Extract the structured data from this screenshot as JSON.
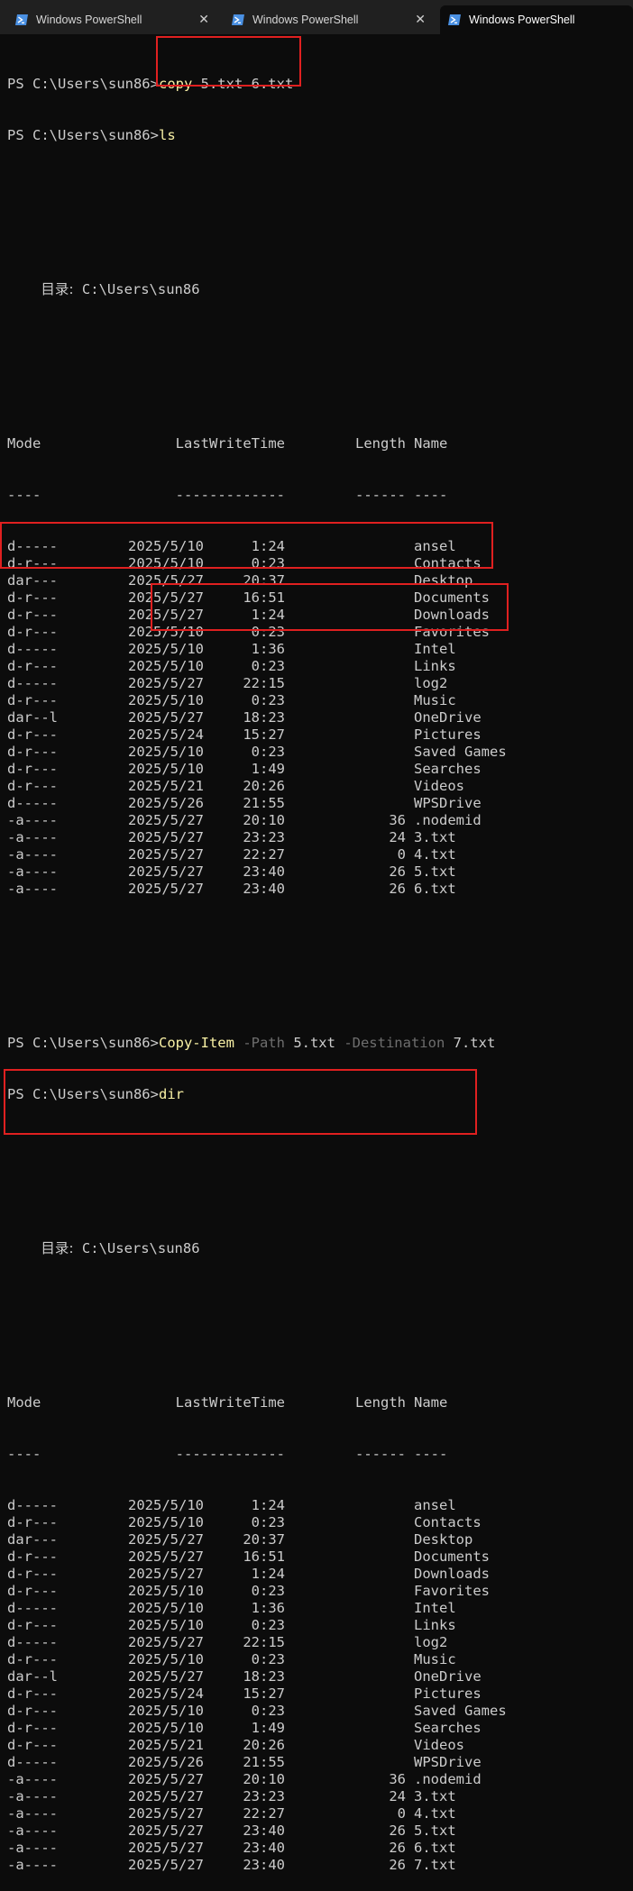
{
  "tabs": [
    {
      "label": "Windows PowerShell",
      "icon": "powershell-icon",
      "active": false,
      "close": "✕"
    },
    {
      "label": "Windows PowerShell",
      "icon": "powershell-icon",
      "active": false,
      "close": "✕"
    },
    {
      "label": "Windows PowerShell",
      "icon": "powershell-icon",
      "active": true
    }
  ],
  "prompt": "PS C:\\Users\\sun86>",
  "session1": {
    "cmd1": {
      "keyword": "copy",
      "args": " 5.txt 6.txt"
    },
    "cmd2": {
      "keyword": "ls"
    }
  },
  "session2": {
    "cmd1": {
      "keyword": "Copy-Item",
      "p1": " -Path",
      "v1": " 5.txt",
      "p2": " -Destination",
      "v2": " 7.txt"
    },
    "cmd2": {
      "keyword": "dir"
    }
  },
  "dir_header": {
    "label": "目录:",
    "path": "C:\\Users\\sun86"
  },
  "columns": {
    "mode": "Mode",
    "time": "LastWriteTime",
    "length": "Length",
    "name": "Name"
  },
  "underlines": {
    "mode": "----",
    "time": "-------------",
    "length": "------",
    "name": "----"
  },
  "listing1": [
    {
      "mode": "d-----",
      "date": "2025/5/10",
      "time": "1:24",
      "length": "",
      "name": "ansel"
    },
    {
      "mode": "d-r---",
      "date": "2025/5/10",
      "time": "0:23",
      "length": "",
      "name": "Contacts"
    },
    {
      "mode": "dar---",
      "date": "2025/5/27",
      "time": "20:37",
      "length": "",
      "name": "Desktop"
    },
    {
      "mode": "d-r---",
      "date": "2025/5/27",
      "time": "16:51",
      "length": "",
      "name": "Documents"
    },
    {
      "mode": "d-r---",
      "date": "2025/5/27",
      "time": "1:24",
      "length": "",
      "name": "Downloads"
    },
    {
      "mode": "d-r---",
      "date": "2025/5/10",
      "time": "0:23",
      "length": "",
      "name": "Favorites"
    },
    {
      "mode": "d-----",
      "date": "2025/5/10",
      "time": "1:36",
      "length": "",
      "name": "Intel"
    },
    {
      "mode": "d-r---",
      "date": "2025/5/10",
      "time": "0:23",
      "length": "",
      "name": "Links"
    },
    {
      "mode": "d-----",
      "date": "2025/5/27",
      "time": "22:15",
      "length": "",
      "name": "log2"
    },
    {
      "mode": "d-r---",
      "date": "2025/5/10",
      "time": "0:23",
      "length": "",
      "name": "Music"
    },
    {
      "mode": "dar--l",
      "date": "2025/5/27",
      "time": "18:23",
      "length": "",
      "name": "OneDrive"
    },
    {
      "mode": "d-r---",
      "date": "2025/5/24",
      "time": "15:27",
      "length": "",
      "name": "Pictures"
    },
    {
      "mode": "d-r---",
      "date": "2025/5/10",
      "time": "0:23",
      "length": "",
      "name": "Saved Games"
    },
    {
      "mode": "d-r---",
      "date": "2025/5/10",
      "time": "1:49",
      "length": "",
      "name": "Searches"
    },
    {
      "mode": "d-r---",
      "date": "2025/5/21",
      "time": "20:26",
      "length": "",
      "name": "Videos"
    },
    {
      "mode": "d-----",
      "date": "2025/5/26",
      "time": "21:55",
      "length": "",
      "name": "WPSDrive"
    },
    {
      "mode": "-a----",
      "date": "2025/5/27",
      "time": "20:10",
      "length": "36",
      "name": ".nodemid"
    },
    {
      "mode": "-a----",
      "date": "2025/5/27",
      "time": "23:23",
      "length": "24",
      "name": "3.txt"
    },
    {
      "mode": "-a----",
      "date": "2025/5/27",
      "time": "22:27",
      "length": "0",
      "name": "4.txt"
    },
    {
      "mode": "-a----",
      "date": "2025/5/27",
      "time": "23:40",
      "length": "26",
      "name": "5.txt"
    },
    {
      "mode": "-a----",
      "date": "2025/5/27",
      "time": "23:40",
      "length": "26",
      "name": "6.txt"
    }
  ],
  "listing2": [
    {
      "mode": "d-----",
      "date": "2025/5/10",
      "time": "1:24",
      "length": "",
      "name": "ansel"
    },
    {
      "mode": "d-r---",
      "date": "2025/5/10",
      "time": "0:23",
      "length": "",
      "name": "Contacts"
    },
    {
      "mode": "dar---",
      "date": "2025/5/27",
      "time": "20:37",
      "length": "",
      "name": "Desktop"
    },
    {
      "mode": "d-r---",
      "date": "2025/5/27",
      "time": "16:51",
      "length": "",
      "name": "Documents"
    },
    {
      "mode": "d-r---",
      "date": "2025/5/27",
      "time": "1:24",
      "length": "",
      "name": "Downloads"
    },
    {
      "mode": "d-r---",
      "date": "2025/5/10",
      "time": "0:23",
      "length": "",
      "name": "Favorites"
    },
    {
      "mode": "d-----",
      "date": "2025/5/10",
      "time": "1:36",
      "length": "",
      "name": "Intel"
    },
    {
      "mode": "d-r---",
      "date": "2025/5/10",
      "time": "0:23",
      "length": "",
      "name": "Links"
    },
    {
      "mode": "d-----",
      "date": "2025/5/27",
      "time": "22:15",
      "length": "",
      "name": "log2"
    },
    {
      "mode": "d-r---",
      "date": "2025/5/10",
      "time": "0:23",
      "length": "",
      "name": "Music"
    },
    {
      "mode": "dar--l",
      "date": "2025/5/27",
      "time": "18:23",
      "length": "",
      "name": "OneDrive"
    },
    {
      "mode": "d-r---",
      "date": "2025/5/24",
      "time": "15:27",
      "length": "",
      "name": "Pictures"
    },
    {
      "mode": "d-r---",
      "date": "2025/5/10",
      "time": "0:23",
      "length": "",
      "name": "Saved Games"
    },
    {
      "mode": "d-r---",
      "date": "2025/5/10",
      "time": "1:49",
      "length": "",
      "name": "Searches"
    },
    {
      "mode": "d-r---",
      "date": "2025/5/21",
      "time": "20:26",
      "length": "",
      "name": "Videos"
    },
    {
      "mode": "d-----",
      "date": "2025/5/26",
      "time": "21:55",
      "length": "",
      "name": "WPSDrive"
    },
    {
      "mode": "-a----",
      "date": "2025/5/27",
      "time": "20:10",
      "length": "36",
      "name": ".nodemid"
    },
    {
      "mode": "-a----",
      "date": "2025/5/27",
      "time": "23:23",
      "length": "24",
      "name": "3.txt"
    },
    {
      "mode": "-a----",
      "date": "2025/5/27",
      "time": "22:27",
      "length": "0",
      "name": "4.txt"
    },
    {
      "mode": "-a----",
      "date": "2025/5/27",
      "time": "23:40",
      "length": "26",
      "name": "5.txt"
    },
    {
      "mode": "-a----",
      "date": "2025/5/27",
      "time": "23:40",
      "length": "26",
      "name": "6.txt"
    },
    {
      "mode": "-a----",
      "date": "2025/5/27",
      "time": "23:40",
      "length": "26",
      "name": "7.txt"
    }
  ],
  "colors": {
    "background": "#0c0c0c",
    "text": "#cccccc",
    "command": "#f9f1a5",
    "parameter": "#6e6e6e",
    "highlight_box": "#e02020",
    "tabbar": "#202020"
  }
}
